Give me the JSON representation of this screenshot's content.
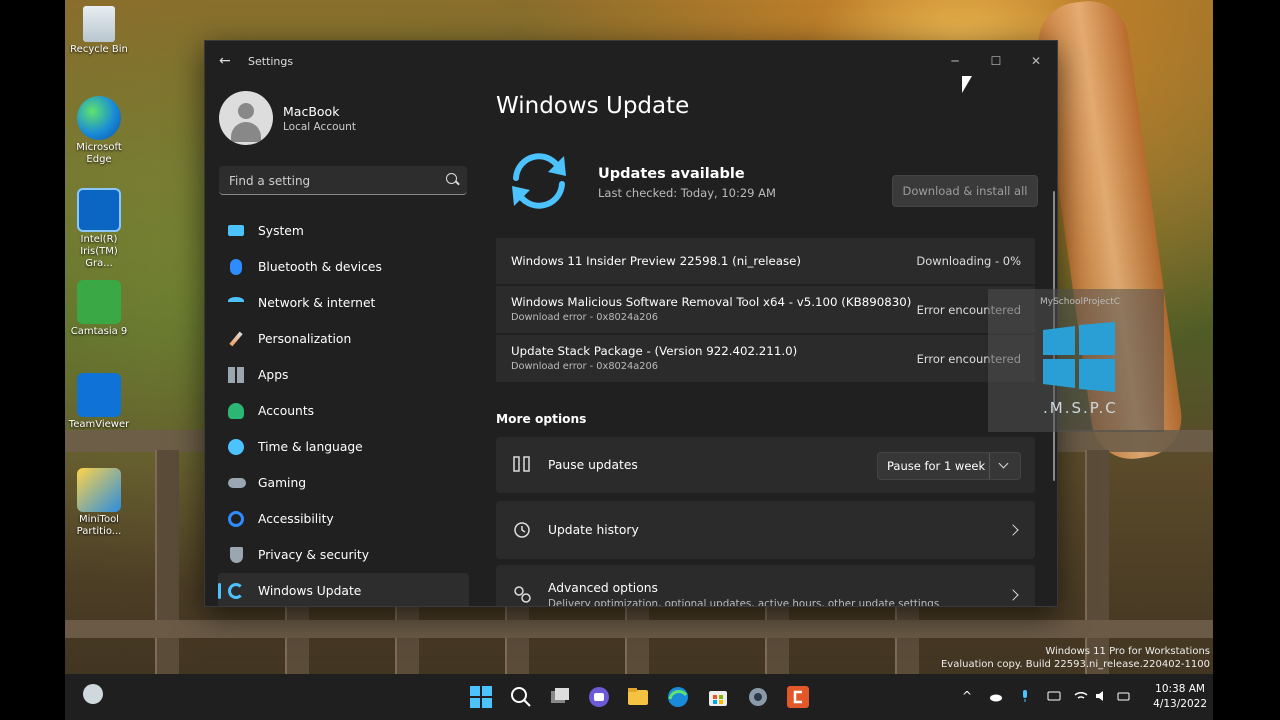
{
  "desktop": {
    "icons": [
      {
        "label": "Recycle Bin"
      },
      {
        "label": "Microsoft Edge"
      },
      {
        "label": "Intel(R) Iris(TM) Gra..."
      },
      {
        "label": "Camtasia 9"
      },
      {
        "label": "TeamViewer"
      },
      {
        "label": "MiniTool Partitio..."
      }
    ],
    "activation_line1": "Windows 11 Pro for Workstations",
    "activation_line2": "Evaluation copy. Build 22593.ni_release.220402-1100",
    "watermark_text": "MySchoolProjectC",
    "watermark_brand": ".M.S.P.C"
  },
  "window": {
    "title": "Settings",
    "back_icon": "back-arrow-icon",
    "controls": {
      "minimize": "─",
      "maximize": "☐",
      "close": "✕"
    }
  },
  "profile": {
    "name": "MacBook",
    "account_type": "Local Account"
  },
  "search": {
    "placeholder": "Find a setting"
  },
  "nav": {
    "items": [
      {
        "label": "System",
        "icon": "system-icon",
        "color": "#4cc2ff"
      },
      {
        "label": "Bluetooth & devices",
        "icon": "bluetooth-icon",
        "color": "#2f8cff"
      },
      {
        "label": "Network & internet",
        "icon": "wifi-icon",
        "color": "#4cc2ff"
      },
      {
        "label": "Personalization",
        "icon": "brush-icon",
        "color": "#f0a060"
      },
      {
        "label": "Apps",
        "icon": "apps-icon",
        "color": "#9aa7b0"
      },
      {
        "label": "Accounts",
        "icon": "person-icon",
        "color": "#2bb673"
      },
      {
        "label": "Time & language",
        "icon": "globe-clock-icon",
        "color": "#4cc2ff"
      },
      {
        "label": "Gaming",
        "icon": "gamepad-icon",
        "color": "#9aa7b0"
      },
      {
        "label": "Accessibility",
        "icon": "accessibility-icon",
        "color": "#2f8cff"
      },
      {
        "label": "Privacy & security",
        "icon": "shield-icon",
        "color": "#9aa7b0"
      },
      {
        "label": "Windows Update",
        "icon": "sync-icon",
        "color": "#4cc2ff"
      }
    ],
    "active_index": 10
  },
  "main": {
    "title": "Windows Update",
    "status_title": "Updates available",
    "status_subtitle": "Last checked: Today, 10:29 AM",
    "download_button": "Download & install all",
    "updates": [
      {
        "name": "Windows 11 Insider Preview 22598.1 (ni_release)",
        "detail": "",
        "status": "Downloading - 0%"
      },
      {
        "name": "Windows Malicious Software Removal Tool x64 - v5.100 (KB890830)",
        "detail": "Download error - 0x8024a206",
        "status": "Error encountered"
      },
      {
        "name": "Update Stack Package - (Version 922.402.211.0)",
        "detail": "Download error - 0x8024a206",
        "status": "Error encountered"
      }
    ],
    "more_options_heading": "More options",
    "options": [
      {
        "name": "Pause updates",
        "icon": "pause-icon",
        "dropdown_value": "Pause for 1 week"
      },
      {
        "name": "Update history",
        "icon": "history-icon"
      },
      {
        "name": "Advanced options",
        "icon": "gears-icon",
        "description": "Delivery optimization, optional updates, active hours, other update settings"
      }
    ]
  },
  "taskbar": {
    "apps": [
      "start-icon",
      "search-icon",
      "task-view-icon",
      "chat-icon",
      "file-explorer-icon",
      "edge-icon",
      "store-icon",
      "settings-icon",
      "camtasia-icon"
    ],
    "tray": [
      "chevron-up-icon",
      "onedrive-icon",
      "microphone-icon",
      "keyboard-icon",
      "wifi-icon",
      "volume-icon",
      "battery-icon"
    ],
    "time": "10:38 AM",
    "date": "4/13/2022"
  },
  "colors": {
    "accent": "#4cc2ff",
    "window_bg": "#202020",
    "card_bg": "#2b2b2b"
  }
}
